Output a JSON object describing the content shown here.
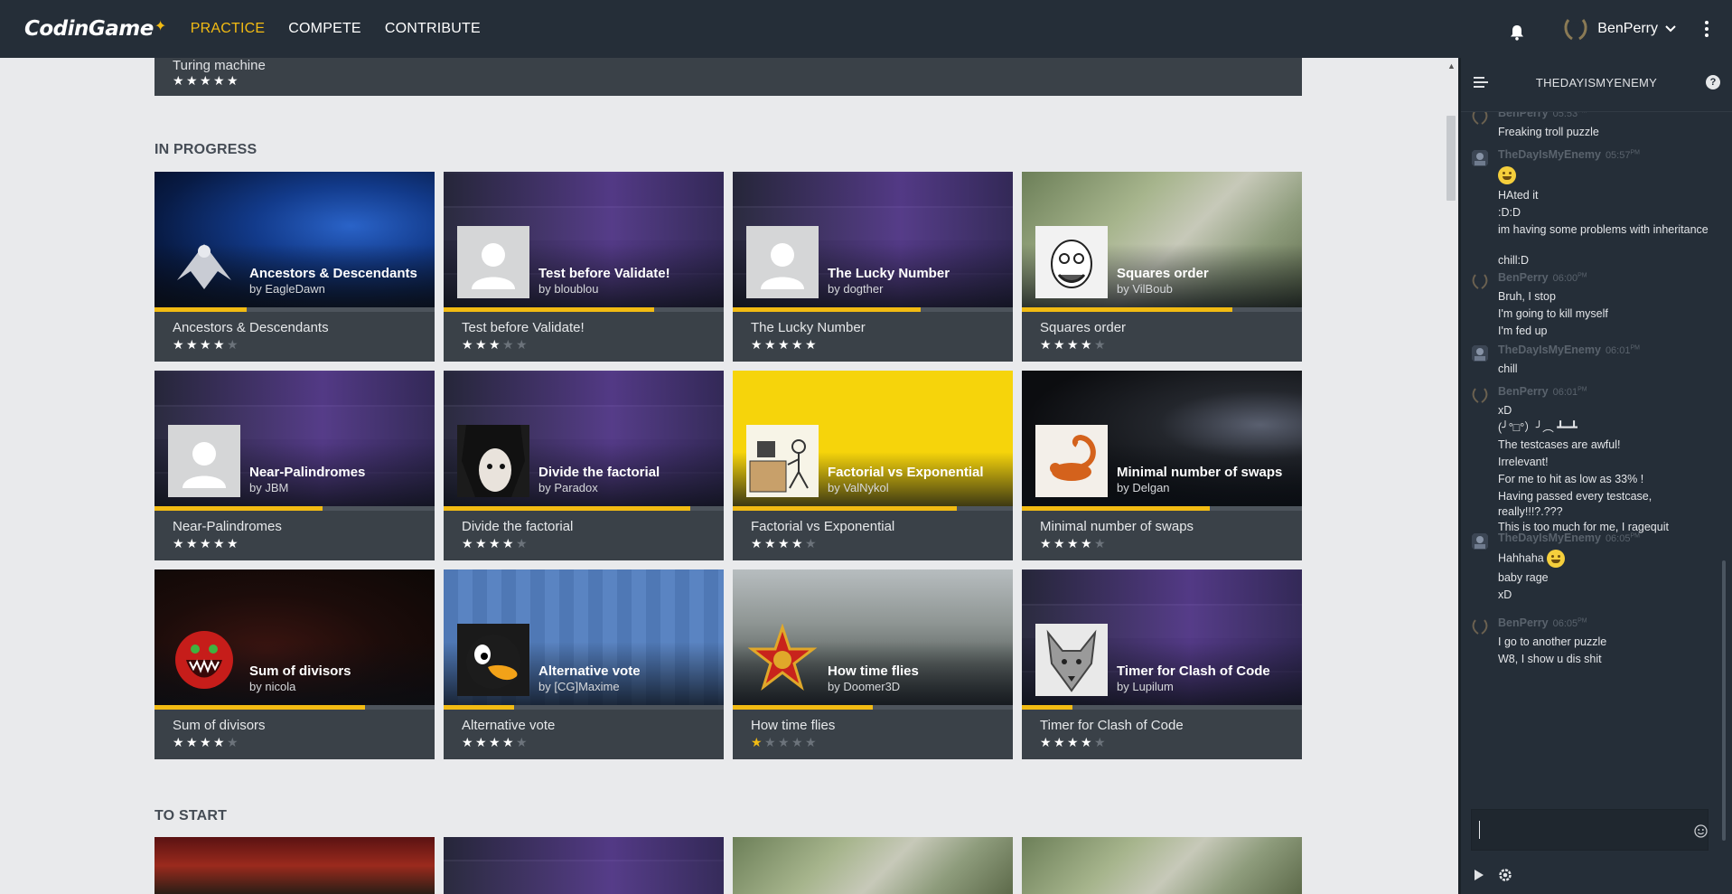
{
  "app": {
    "logo_main": "CodinGame",
    "nav": [
      {
        "label": "PRACTICE",
        "active": true
      },
      {
        "label": "COMPETE",
        "active": false
      },
      {
        "label": "CONTRIBUTE",
        "active": false
      }
    ],
    "username": "BenPerry",
    "accent_color": "#f2bb13"
  },
  "top_partial": {
    "name": "Turing machine",
    "stars": 5
  },
  "sections": {
    "in_progress": "IN PROGRESS",
    "to_start": "TO START"
  },
  "puzzles": [
    {
      "title": "Ancestors & Descendants",
      "author": "by EagleDawn",
      "name": "Ancestors & Descendants",
      "progress": 0.33,
      "stars": 4
    },
    {
      "title": "Test before Validate!",
      "author": "by bloublou",
      "name": "Test before Validate!",
      "progress": 0.75,
      "stars": 3
    },
    {
      "title": "The Lucky Number",
      "author": "by dogther",
      "name": "The Lucky Number",
      "progress": 0.67,
      "stars": 5
    },
    {
      "title": "Squares order",
      "author": "by VilBoub",
      "name": "Squares order",
      "progress": 0.75,
      "stars": 4
    },
    {
      "title": "Near-Palindromes",
      "author": "by JBM",
      "name": "Near-Palindromes",
      "progress": 0.6,
      "stars": 5
    },
    {
      "title": "Divide the factorial",
      "author": "by Paradox",
      "name": "Divide the factorial",
      "progress": 0.88,
      "stars": 4
    },
    {
      "title": "Factorial vs Exponential",
      "author": "by ValNykol",
      "name": "Factorial vs Exponential",
      "progress": 0.8,
      "stars": 4
    },
    {
      "title": "Minimal number of swaps",
      "author": "by Delgan",
      "name": "Minimal number of swaps",
      "progress": 0.67,
      "stars": 4
    },
    {
      "title": "Sum of divisors",
      "author": "by nicola",
      "name": "Sum of divisors",
      "progress": 0.75,
      "stars": 4
    },
    {
      "title": "Alternative vote",
      "author": "by [CG]Maxime",
      "name": "Alternative vote",
      "progress": 0.25,
      "stars": 4
    },
    {
      "title": "How time flies",
      "author": "by Doomer3D",
      "name": "How time flies",
      "progress": 0.5,
      "stars": 1,
      "gold": true
    },
    {
      "title": "Timer for Clash of Code",
      "author": "by Lupilum",
      "name": "Timer for Clash of Code",
      "progress": 0.18,
      "stars": 4
    }
  ],
  "chat": {
    "room": "THEDAYISMYENEMY",
    "groups": [
      {
        "user": "BenPerry",
        "time": "05:53",
        "ampm": "PM",
        "lines": [
          "Freaking troll puzzle"
        ]
      },
      {
        "user": "TheDayIsMyEnemy",
        "time": "05:57",
        "ampm": "PM",
        "lines": [
          "",
          "HAted it",
          ":D:D",
          "im having some problems with inheritance",
          "chill:D"
        ]
      },
      {
        "user": "BenPerry",
        "time": "06:00",
        "ampm": "PM",
        "lines": [
          "Bruh, I stop",
          "I'm going to kill myself",
          "I'm fed up"
        ]
      },
      {
        "user": "TheDayIsMyEnemy",
        "time": "06:01",
        "ampm": "PM",
        "lines": [
          "chill"
        ]
      },
      {
        "user": "BenPerry",
        "time": "06:01",
        "ampm": "PM",
        "lines": [
          "xD",
          "(╯°□°）╯︵ ┻━┻",
          "The testcases are awful!",
          "Irrelevant!",
          "For me to hit as low as 33% !",
          "Having passed every testcase, really!!!?.???",
          "This is too much for me, I ragequit"
        ]
      },
      {
        "user": "TheDayIsMyEnemy",
        "time": "06:05",
        "ampm": "PM",
        "lines": [
          "Hahhaha",
          "baby rage",
          "xD"
        ]
      },
      {
        "user": "BenPerry",
        "time": "06:05",
        "ampm": "PM",
        "lines": [
          "I go to another puzzle",
          "W8, I show u dis shit"
        ]
      }
    ],
    "input_value": ""
  },
  "icons": [
    "bell-icon",
    "laurel-avatar-icon",
    "chevron-down-icon",
    "kebab-menu-icon",
    "menu-lines-icon",
    "help-icon",
    "smiley-icon",
    "play-icon",
    "gear-icon",
    "star-icon"
  ]
}
